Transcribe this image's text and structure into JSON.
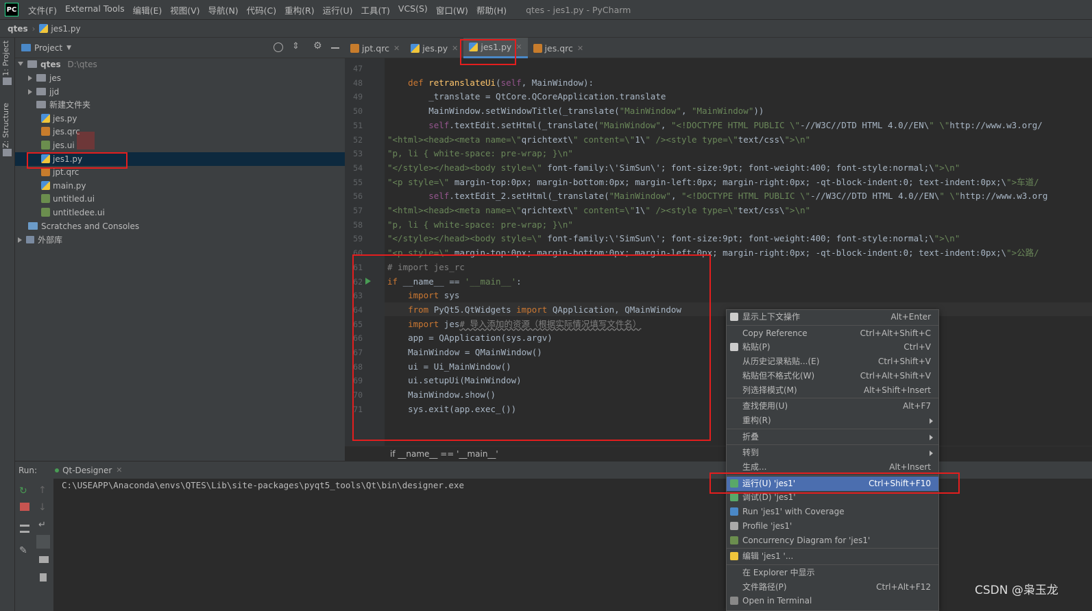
{
  "menubar": {
    "logo": "PC",
    "items": [
      "文件(F)",
      "External Tools",
      "编辑(E)",
      "视图(V)",
      "导航(N)",
      "代码(C)",
      "重构(R)",
      "运行(U)",
      "工具(T)",
      "VCS(S)",
      "窗口(W)",
      "帮助(H)"
    ],
    "title": "qtes - jes1.py - PyCharm"
  },
  "nav": {
    "project": "qtes",
    "file": "jes1.py"
  },
  "sidetabs": {
    "project": "1: Project",
    "structure": "Z: Structure"
  },
  "project": {
    "title": "Project",
    "root_name": "qtes",
    "root_path": "D:\\qtes",
    "items": [
      {
        "label": "jes",
        "kind": "folder",
        "arrow": "right"
      },
      {
        "label": "jjd",
        "kind": "folder",
        "arrow": "right"
      },
      {
        "label": "新建文件夹",
        "kind": "folder",
        "arrow": ""
      },
      {
        "label": "jes.py",
        "kind": "py"
      },
      {
        "label": "jes.qrc",
        "kind": "qrc"
      },
      {
        "label": "jes.ui",
        "kind": "ui"
      },
      {
        "label": "jes1.py",
        "kind": "py",
        "selected": true
      },
      {
        "label": "jpt.qrc",
        "kind": "qrc"
      },
      {
        "label": "main.py",
        "kind": "py"
      },
      {
        "label": "untitled.ui",
        "kind": "ui"
      },
      {
        "label": "untitledee.ui",
        "kind": "ui"
      }
    ],
    "scratches": "Scratches and Consoles",
    "external": "外部库"
  },
  "tabs": [
    {
      "label": "jpt.qrc",
      "kind": "qrc"
    },
    {
      "label": "jes.py",
      "kind": "py"
    },
    {
      "label": "jes1.py",
      "kind": "py",
      "active": true
    },
    {
      "label": "jes.qrc",
      "kind": "qrc"
    }
  ],
  "lines": [
    {
      "n": "47",
      "t": ""
    },
    {
      "n": "48",
      "t": "    def retranslateUi(self, MainWindow):"
    },
    {
      "n": "49",
      "t": "        _translate = QtCore.QCoreApplication.translate"
    },
    {
      "n": "50",
      "t": "        MainWindow.setWindowTitle(_translate(\"MainWindow\", \"MainWindow\"))"
    },
    {
      "n": "51",
      "t": "        self.textEdit.setHtml(_translate(\"MainWindow\", \"<!DOCTYPE HTML PUBLIC \\\"-//W3C//DTD HTML 4.0//EN\\\" \\\"http://www.w3.org/"
    },
    {
      "n": "52",
      "t": "\"<html><head><meta name=\\\"qrichtext\\\" content=\\\"1\\\" /><style type=\\\"text/css\\\">\\n\""
    },
    {
      "n": "53",
      "t": "\"p, li { white-space: pre-wrap; }\\n\""
    },
    {
      "n": "54",
      "t": "\"</style></head><body style=\\\" font-family:\\'SimSun\\'; font-size:9pt; font-weight:400; font-style:normal;\\\">\\n\""
    },
    {
      "n": "55",
      "t": "\"<p style=\\\" margin-top:0px; margin-bottom:0px; margin-left:0px; margin-right:0px; -qt-block-indent:0; text-indent:0px;\\\">车道/"
    },
    {
      "n": "56",
      "t": "        self.textEdit_2.setHtml(_translate(\"MainWindow\", \"<!DOCTYPE HTML PUBLIC \\\"-//W3C//DTD HTML 4.0//EN\\\" \\\"http://www.w3.org"
    },
    {
      "n": "57",
      "t": "\"<html><head><meta name=\\\"qrichtext\\\" content=\\\"1\\\" /><style type=\\\"text/css\\\">\\n\""
    },
    {
      "n": "58",
      "t": "\"p, li { white-space: pre-wrap; }\\n\""
    },
    {
      "n": "59",
      "t": "\"</style></head><body style=\\\" font-family:\\'SimSun\\'; font-size:9pt; font-weight:400; font-style:normal;\\\">\\n\""
    },
    {
      "n": "60",
      "t": "\"<p style=\\\" margin-top:0px; margin-bottom:0px; margin-left:0px; margin-right:0px; -qt-block-indent:0; text-indent:0px;\\\">公路/"
    },
    {
      "n": "61",
      "t": "# import jes_rc"
    },
    {
      "n": "62",
      "t": "if __name__ == '__main__':"
    },
    {
      "n": "63",
      "t": "    import sys"
    },
    {
      "n": "64",
      "t": "    from PyQt5.QtWidgets import QApplication, QMainWindow"
    },
    {
      "n": "65",
      "t": "    import jes# 导入添加的资源（根据实际情况填写文件名）"
    },
    {
      "n": "66",
      "t": "    app = QApplication(sys.argv)"
    },
    {
      "n": "67",
      "t": "    MainWindow = QMainWindow()"
    },
    {
      "n": "68",
      "t": "    ui = Ui_MainWindow()"
    },
    {
      "n": "69",
      "t": "    ui.setupUi(MainWindow)"
    },
    {
      "n": "70",
      "t": "    MainWindow.show()"
    },
    {
      "n": "71",
      "t": "    sys.exit(app.exec_())"
    }
  ],
  "breadcrumb": "if __name__ == '__main__'",
  "run": {
    "label": "Run:",
    "config": "Qt-Designer",
    "output": "C:\\USEAPP\\Anaconda\\envs\\QTES\\Lib\\site-packages\\pyqt5_tools\\Qt\\bin\\designer.exe"
  },
  "context_menu": [
    {
      "label": "显示上下文操作",
      "shortcut": "Alt+Enter",
      "icon": "bulb-icon"
    },
    {
      "sep": true
    },
    {
      "label": "Copy Reference",
      "shortcut": "Ctrl+Alt+Shift+C"
    },
    {
      "label": "粘贴(P)",
      "shortcut": "Ctrl+V",
      "icon": "clipboard-icon"
    },
    {
      "label": "从历史记录粘贴...(E)",
      "shortcut": "Ctrl+Shift+V"
    },
    {
      "label": "粘贴但不格式化(W)",
      "shortcut": "Ctrl+Alt+Shift+V"
    },
    {
      "label": "列选择模式(M)",
      "shortcut": "Alt+Shift+Insert"
    },
    {
      "sep": true
    },
    {
      "label": "查找使用(U)",
      "shortcut": "Alt+F7"
    },
    {
      "label": "重构(R)",
      "submenu": true
    },
    {
      "sep": true
    },
    {
      "label": "折叠",
      "submenu": true
    },
    {
      "sep": true
    },
    {
      "label": "转到",
      "submenu": true
    },
    {
      "label": "生成...",
      "shortcut": "Alt+Insert"
    },
    {
      "sep": true
    },
    {
      "label": "运行(U) 'jes1'",
      "shortcut": "Ctrl+Shift+F10",
      "icon": "run-icon",
      "highlighted": true
    },
    {
      "label": "调试(D) 'jes1'",
      "icon": "debug-icon"
    },
    {
      "label": "Run 'jes1' with Coverage",
      "icon": "coverage-icon"
    },
    {
      "label": "Profile 'jes1'",
      "icon": "profile-icon"
    },
    {
      "label": "Concurrency Diagram for 'jes1'",
      "icon": "concurrency-icon"
    },
    {
      "sep": true
    },
    {
      "label": "编辑 'jes1 '...",
      "icon": "python-icon"
    },
    {
      "sep": true
    },
    {
      "label": "在 Explorer 中显示"
    },
    {
      "label": "文件路径(P)",
      "shortcut": "Ctrl+Alt+F12"
    },
    {
      "label": "Open in Terminal",
      "icon": "terminal-icon"
    }
  ],
  "watermark": "CSDN @枭玉龙",
  "colors": {
    "keyword": "#cc7832",
    "string": "#6a8759",
    "comment": "#808080",
    "function": "#ffc66d",
    "self": "#94558d",
    "highlight": "#4b6eaf",
    "annotation": "#e41e1e",
    "selection": "#0d293e"
  }
}
